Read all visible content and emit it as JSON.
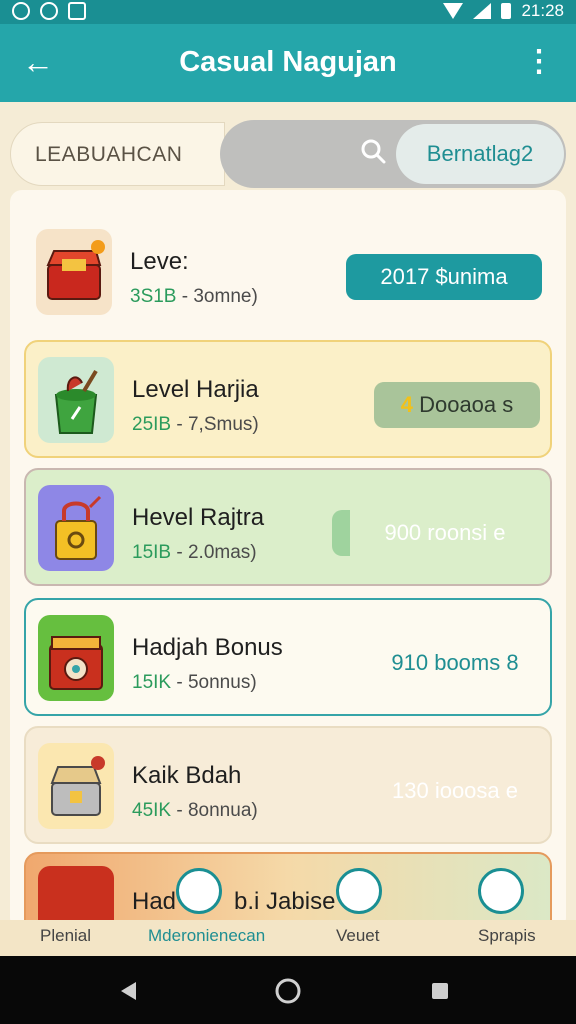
{
  "statusbar": {
    "time": "21:28"
  },
  "appbar": {
    "back": "←",
    "title": "Casual Nagujan",
    "more": "⋮"
  },
  "tabs": {
    "leaderboard": "LEABUAHCAN",
    "right": "Bernatlag2"
  },
  "rows": [
    {
      "name": "Leve:",
      "sub_num": "3S1B",
      "sub_rest": " - 3omne)",
      "btn": "2017 $unima"
    },
    {
      "name": "Level Harjia",
      "sub_num": "25IB",
      "sub_rest": " - 7,Smus)",
      "btn_num": "4",
      "btn_rest": " Dooaoa s"
    },
    {
      "name": "Hevel Rajtra",
      "sub_num": "15IB",
      "sub_rest": " - 2.0mas)",
      "btn": "900 roonsi e"
    },
    {
      "name": "Hadjah Bonus",
      "sub_num": "15IK",
      "sub_rest": " - 5onnus)",
      "btn": "910 booms 8"
    },
    {
      "name": "Kaik Bdah",
      "sub_num": "45IK",
      "sub_rest": " - 8onnua)",
      "btn": "130 iooosa e"
    },
    {
      "name": "Had",
      "partial_extra": "b.i Jabise"
    }
  ],
  "bottomnav": {
    "item1": "Plenial",
    "item2": "Mderonienecan",
    "item3": "Veuet",
    "item4": "Sprapis"
  },
  "colors": {
    "teal": "#25a6aa",
    "dark_teal": "#1a8f93",
    "yellow_card": "#fbf0c8",
    "green_card": "#dbeeca",
    "peach_card": "#f7ecd8"
  }
}
